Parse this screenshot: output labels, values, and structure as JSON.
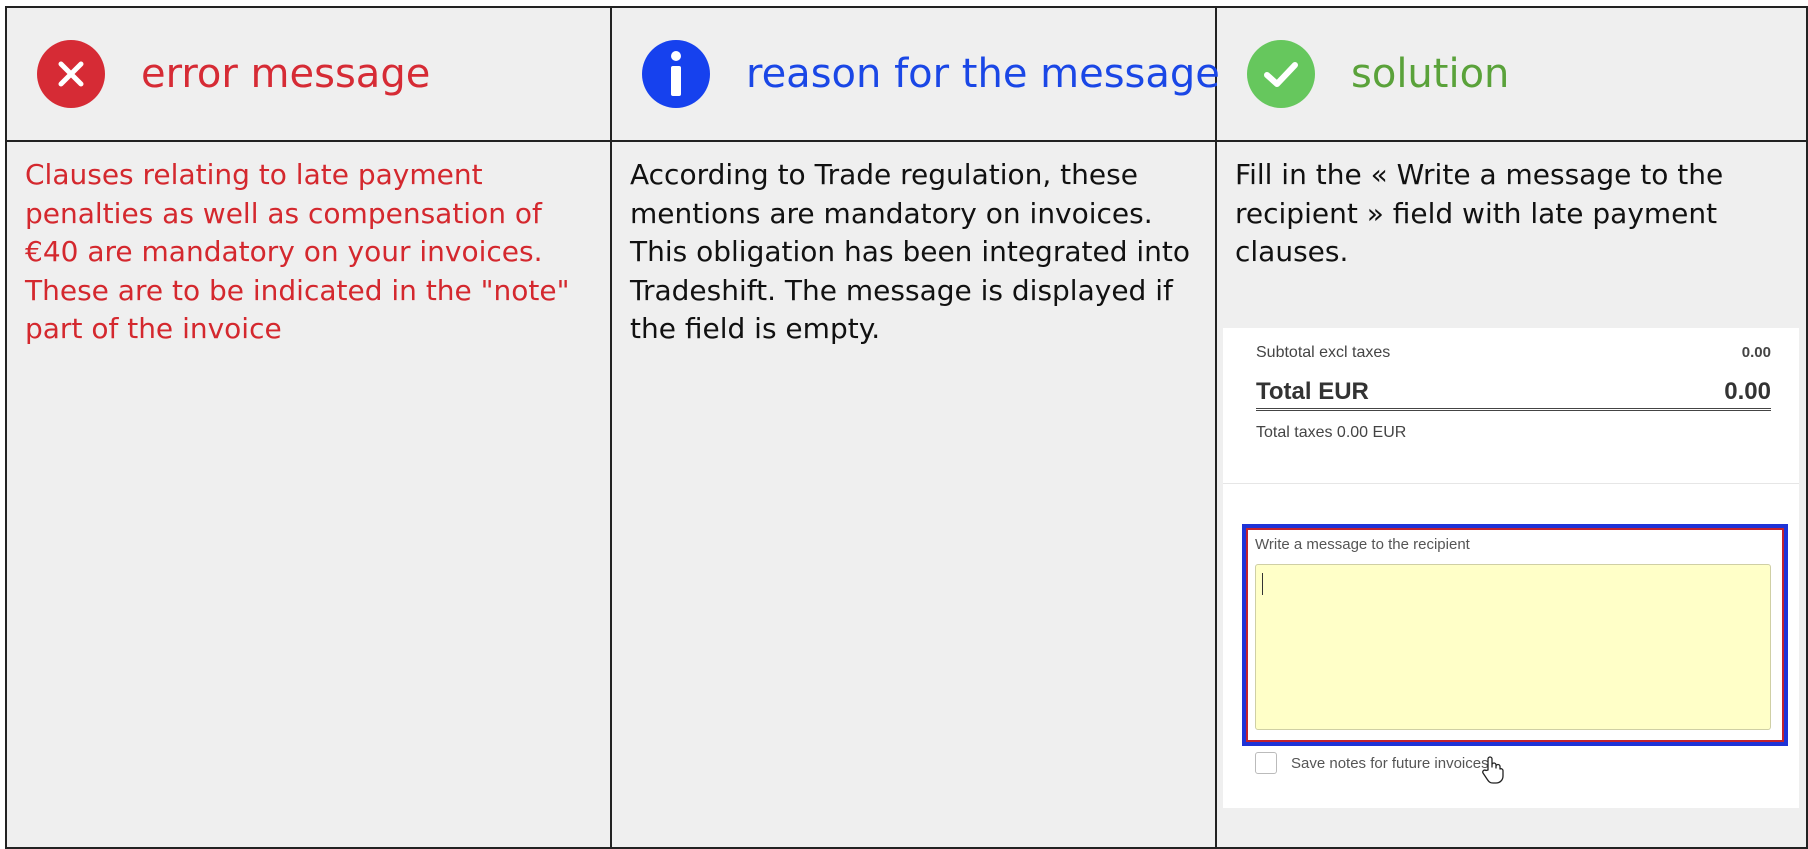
{
  "columns": [
    {
      "title": "error message",
      "icon": "close-circle-icon",
      "color": "#d62b35",
      "text": "Clauses relating to late payment penalties as well as compensation of €40 are mandatory on your invoices. These are to be indicated in the \"note\" part of the invoice"
    },
    {
      "title": "reason for the message",
      "icon": "info-circle-icon",
      "color": "#1641ee",
      "text": "According to Trade regulation, these mentions are mandatory on invoices. This obligation has been integrated into Tradeshift. The message is displayed if the field is empty."
    },
    {
      "title": "solution",
      "icon": "check-circle-icon",
      "color": "#66c75d",
      "text": "Fill in the « Write a message to the recipient » field with late payment clauses."
    }
  ],
  "screenshot": {
    "subtotal_label": "Subtotal excl taxes",
    "subtotal_value": "0.00",
    "total_label": "Total EUR",
    "total_value": "0.00",
    "taxes_text": "Total taxes 0.00 EUR",
    "message_label": "Write a message to the recipient",
    "message_value": "",
    "save_notes_label": "Save notes for future invoices",
    "save_notes_checked": false,
    "highlight_color": "#1f33d6",
    "field_background": "#ffffc8"
  }
}
